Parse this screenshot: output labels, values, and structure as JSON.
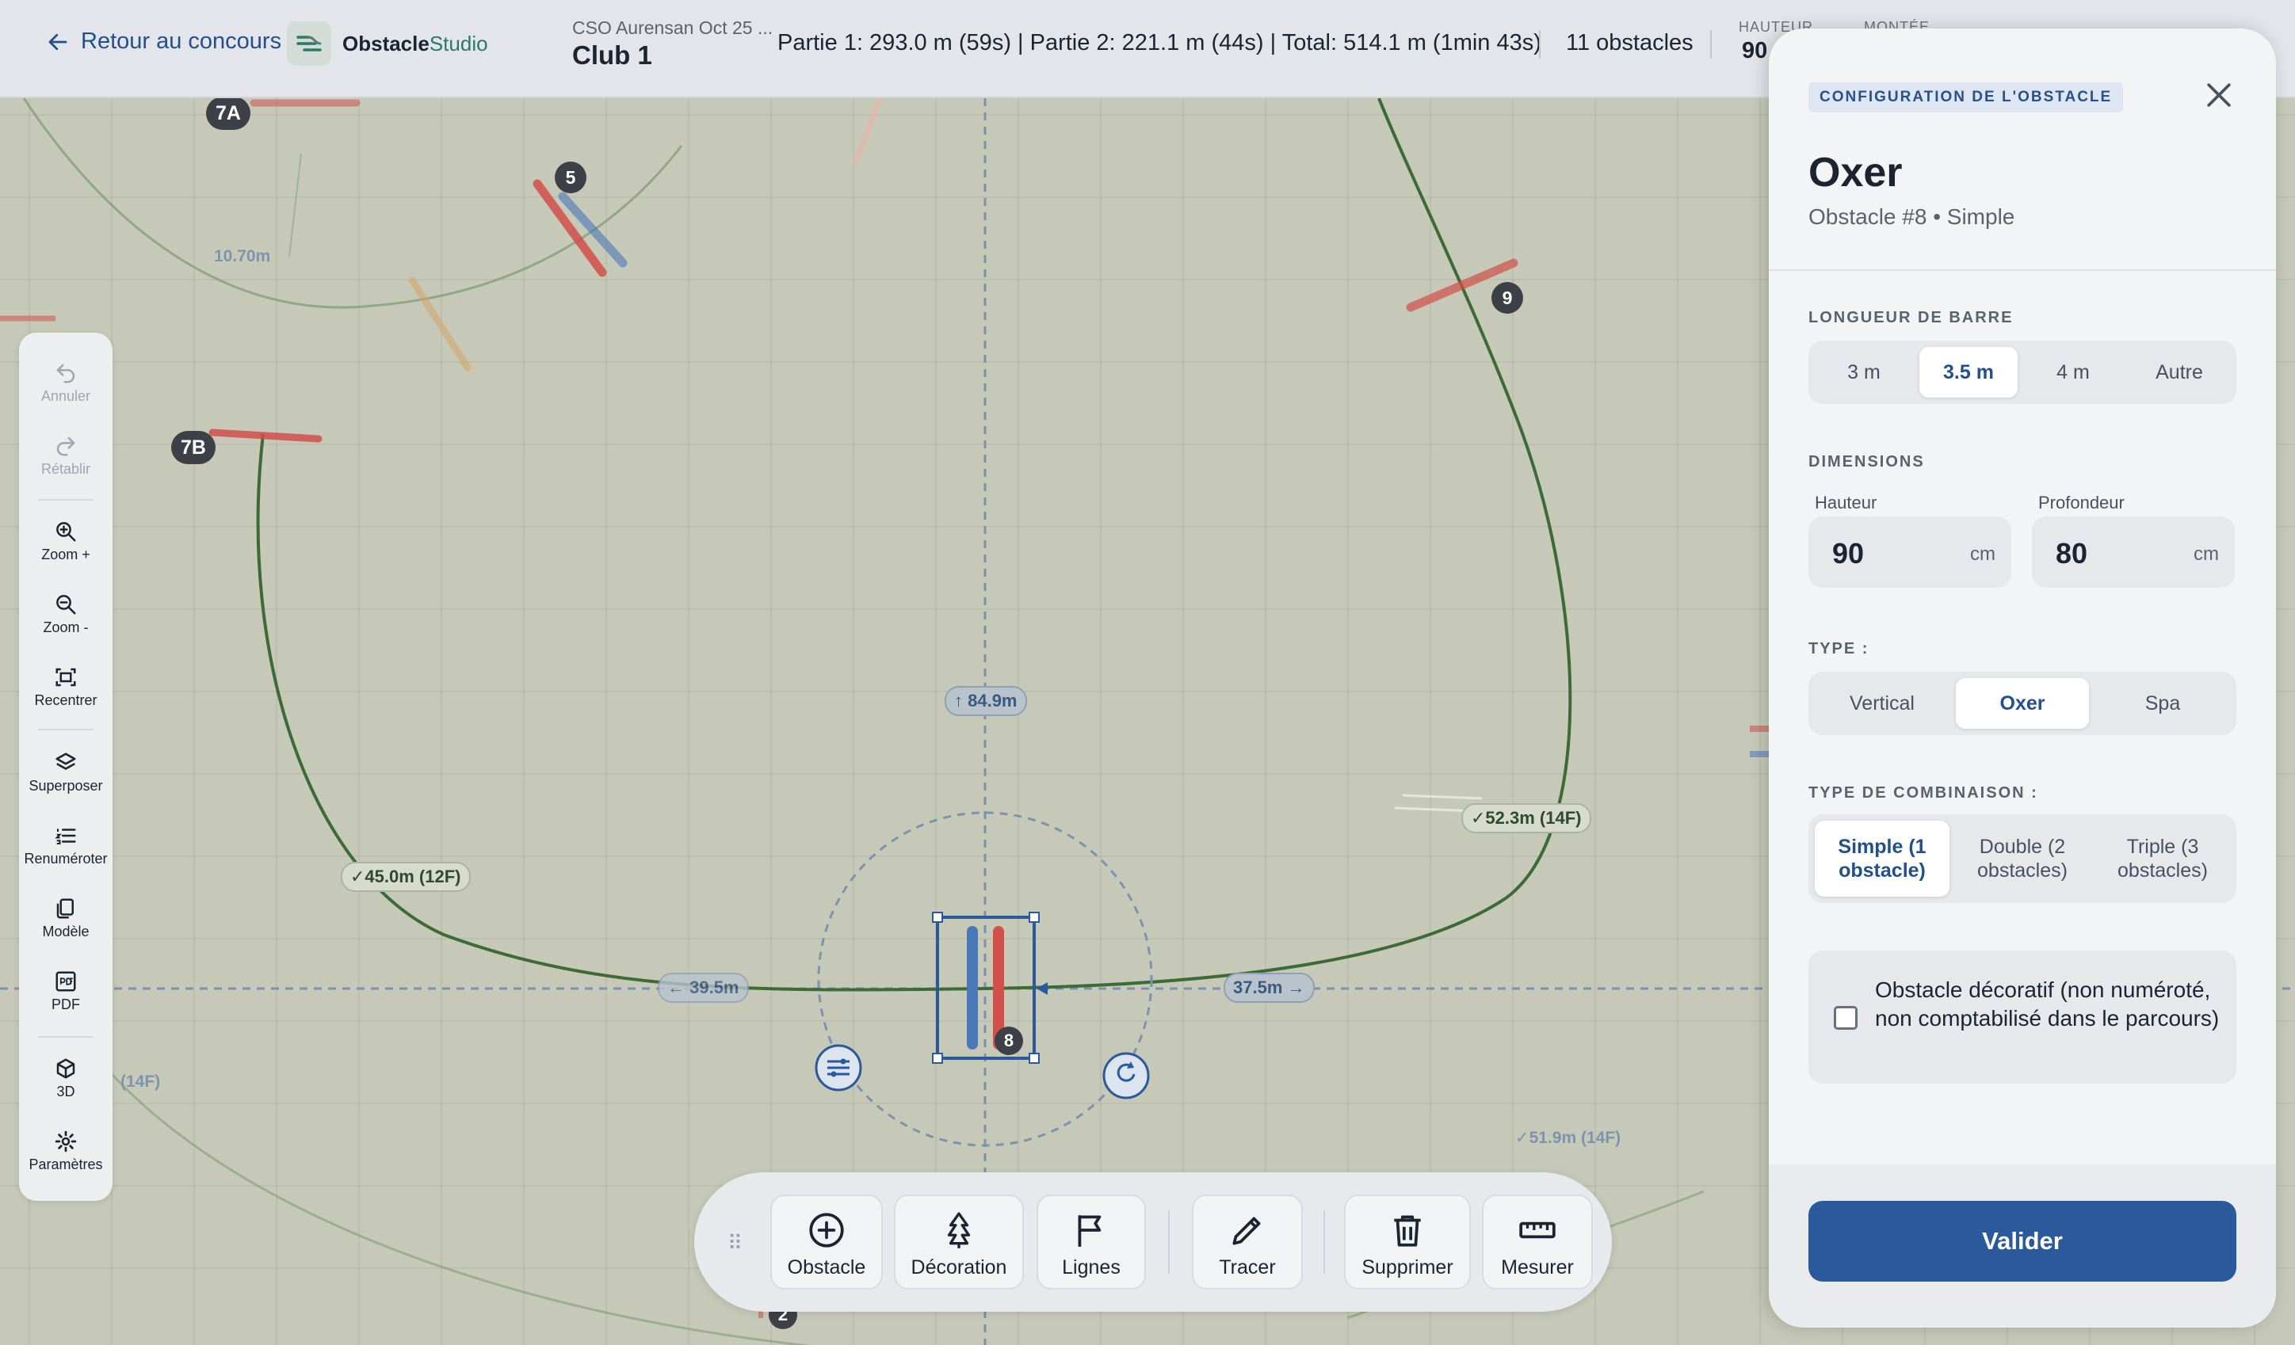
{
  "header": {
    "back_label": "Retour au concours",
    "logo_primary": "Obstacle",
    "logo_secondary": "Studio",
    "event_subtitle": "CSO Aurensan Oct 25 ...",
    "event_title": "Club 1",
    "stats_text": "Partie 1: 293.0 m (59s) | Partie 2: 221.1 m (44s) | Total: 514.1 m (1min 43s)",
    "obstacle_count": "11 obstacles",
    "height_label": "HAUTEUR",
    "height_value": "90",
    "extra_label": "MONTÉE"
  },
  "course": {
    "obstacle_labels": [
      "7A",
      "5",
      "9",
      "7B",
      "8",
      "2"
    ],
    "distance_labels": [
      "10.70m",
      "↑ 84.9m",
      "✓45.0m (12F)",
      "✓52.3m (14F)",
      "← 39.5m",
      "37.5m →",
      "(14F)",
      "✓51.9m (14F)"
    ],
    "colors": {
      "track": "#3d6b35",
      "blue_pole": "#4a78b8",
      "red_pole": "#d2504a",
      "selection": "#2a5a9c"
    }
  },
  "left_toolbar": {
    "items": [
      {
        "label": "Annuler",
        "icon": "undo-icon",
        "enabled": false
      },
      {
        "label": "Rétablir",
        "icon": "redo-icon",
        "enabled": false
      },
      {
        "label": "Zoom +",
        "icon": "zoom-in-icon",
        "enabled": true
      },
      {
        "label": "Zoom -",
        "icon": "zoom-out-icon",
        "enabled": true
      },
      {
        "label": "Recentrer",
        "icon": "recenter-icon",
        "enabled": true
      },
      {
        "label": "Superposer",
        "icon": "layers-icon",
        "enabled": true
      },
      {
        "label": "Renuméroter",
        "icon": "renumber-icon",
        "enabled": true
      },
      {
        "label": "Modèle",
        "icon": "template-icon",
        "enabled": true
      },
      {
        "label": "PDF",
        "icon": "pdf-icon",
        "enabled": true
      },
      {
        "label": "3D",
        "icon": "cube-3d-icon",
        "enabled": true
      },
      {
        "label": "Paramètres",
        "icon": "settings-gear-icon",
        "enabled": true
      }
    ]
  },
  "bottom_toolbar": {
    "items": [
      {
        "label": "Obstacle",
        "icon": "plus-circle-icon"
      },
      {
        "label": "Décoration",
        "icon": "tree-icon"
      },
      {
        "label": "Lignes",
        "icon": "flag-icon"
      },
      {
        "label": "Tracer",
        "icon": "pencil-icon"
      },
      {
        "label": "Supprimer",
        "icon": "trash-icon"
      },
      {
        "label": "Mesurer",
        "icon": "ruler-icon"
      }
    ]
  },
  "panel": {
    "badge": "CONFIGURATION DE L'OBSTACLE",
    "title": "Oxer",
    "subtitle": "Obstacle #8 • Simple",
    "bar_length": {
      "label": "LONGUEUR DE BARRE",
      "options": [
        "3 m",
        "3.5 m",
        "4 m",
        "Autre"
      ],
      "selected": "3.5 m"
    },
    "dimensions": {
      "label": "DIMENSIONS",
      "height_label": "Hauteur",
      "height_value": "90",
      "depth_label": "Profondeur",
      "depth_value": "80",
      "unit": "cm"
    },
    "type": {
      "label": "TYPE :",
      "options": [
        "Vertical",
        "Oxer",
        "Spa"
      ],
      "selected": "Oxer"
    },
    "combination": {
      "label": "TYPE DE COMBINAISON :",
      "options": [
        "Simple (1 obstacle)",
        "Double (2 obstacles)",
        "Triple (3 obstacles)"
      ],
      "selected": "Simple (1 obstacle)"
    },
    "decorative_checkbox_label": "Obstacle décoratif (non numéroté, non comptabilisé dans le parcours)",
    "decorative_checked": false,
    "validate_label": "Valider"
  }
}
